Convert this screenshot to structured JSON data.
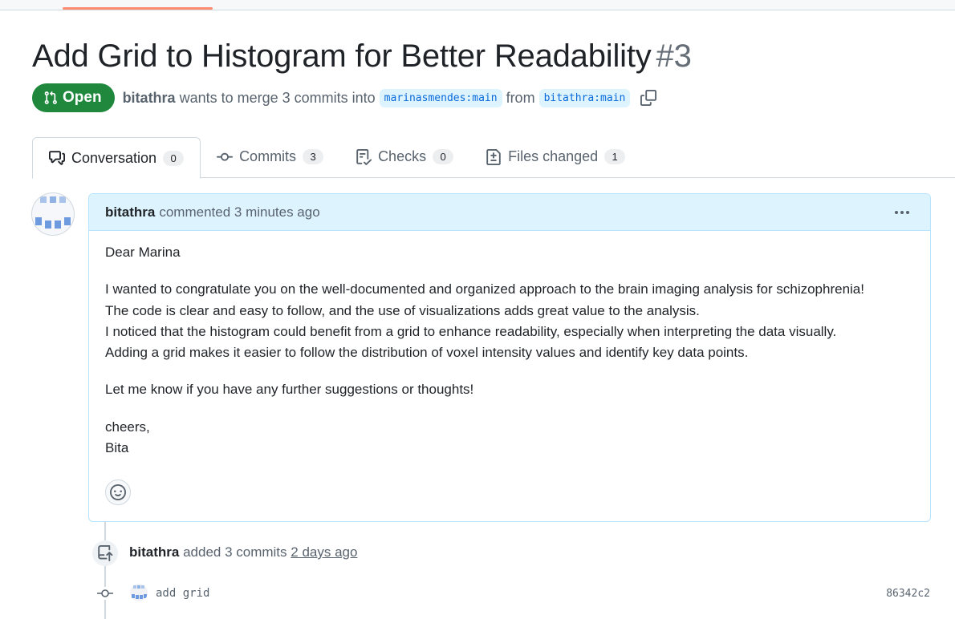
{
  "pr": {
    "title": "Add Grid to Histogram for Better Readability",
    "number": "#3",
    "state_label": "Open",
    "author": "bitathra",
    "merge_text": "wants to merge 3 commits into",
    "base_branch": "marinasmendes:main",
    "from_text": "from",
    "head_branch": "bitathra:main"
  },
  "tabs": [
    {
      "label": "Conversation",
      "count": "0",
      "icon": "comment-discussion-icon"
    },
    {
      "label": "Commits",
      "count": "3",
      "icon": "git-commit-icon"
    },
    {
      "label": "Checks",
      "count": "0",
      "icon": "checklist-icon"
    },
    {
      "label": "Files changed",
      "count": "1",
      "icon": "file-diff-icon"
    }
  ],
  "comment": {
    "author": "bitathra",
    "action": "commented 3 minutes ago",
    "greeting": "Dear Marina",
    "lines": [
      "I wanted to congratulate you on the well-documented and organized approach to the brain imaging analysis for schizophrenia!",
      "The code is clear and easy to follow, and the use of visualizations adds great value to the analysis.",
      "I noticed that the histogram could benefit from a grid to enhance readability, especially when interpreting the data visually.",
      "Adding a grid makes it easier to follow the distribution of voxel intensity values and identify key data points."
    ],
    "closing": "Let me know if you have any further suggestions or thoughts!",
    "signoff": "cheers,",
    "name": "Bita"
  },
  "event": {
    "author": "bitathra",
    "text": "added 3 commits",
    "time": "2 days ago"
  },
  "commits": [
    {
      "message": "add grid",
      "sha": "86342c2"
    }
  ],
  "colors": {
    "open_green": "#1f883d",
    "branch_bg": "#ddf4ff",
    "branch_text": "#0969da",
    "comment_header_bg": "#ddf4ff",
    "tab_accent": "#fd8c73"
  }
}
